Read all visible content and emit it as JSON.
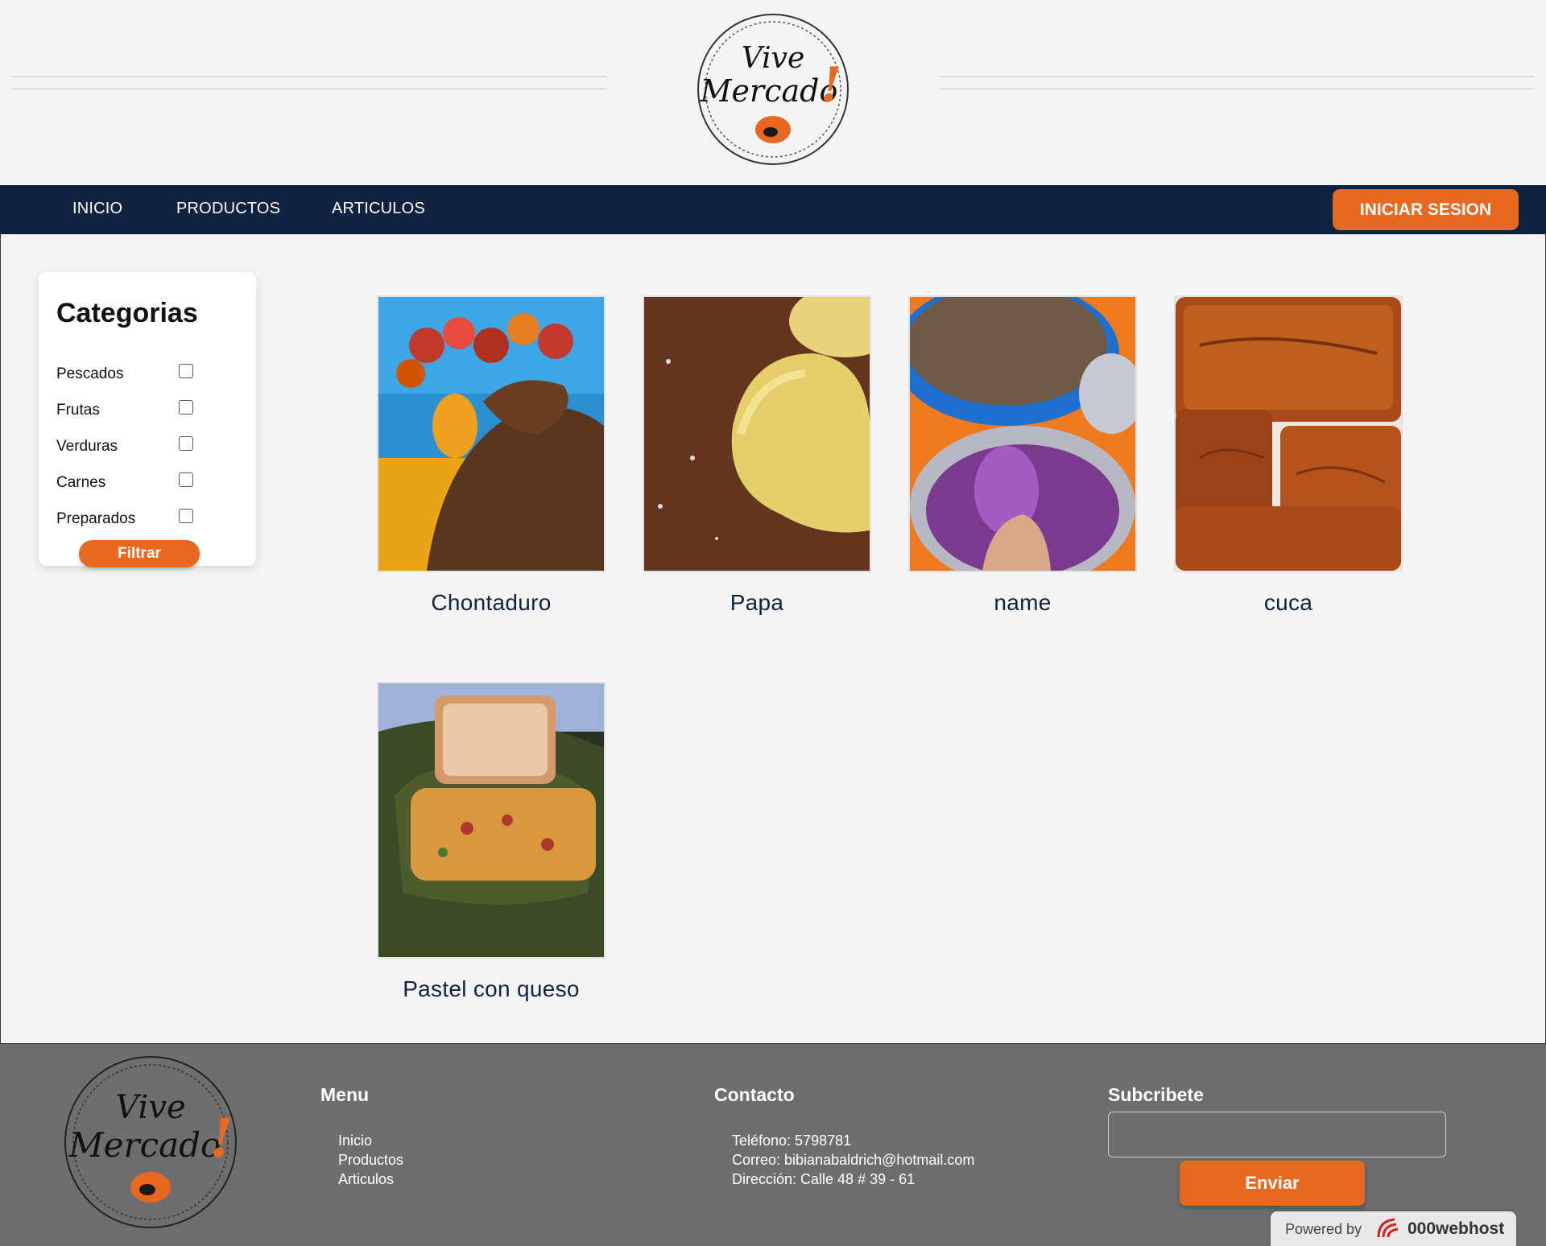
{
  "brand": {
    "logo_line1": "Vive",
    "logo_line2": "Mercado",
    "logo_mark": "!"
  },
  "nav": {
    "items": [
      "INICIO",
      "PRODUCTOS",
      "ARTICULOS"
    ],
    "login_label": "INICIAR SESION"
  },
  "categories": {
    "title": "Categorias",
    "items": [
      "Pescados",
      "Frutas",
      "Verduras",
      "Carnes",
      "Preparados"
    ],
    "filter_label": "Filtrar"
  },
  "products": [
    {
      "name": "Chontaduro"
    },
    {
      "name": "Papa"
    },
    {
      "name": "name"
    },
    {
      "name": "cuca"
    },
    {
      "name": "Pastel con queso"
    }
  ],
  "footer": {
    "menu_title": "Menu",
    "menu_items": [
      "Inicio",
      "Productos",
      "Articulos"
    ],
    "contact_title": "Contacto",
    "phone": "Teléfono: 5798781",
    "email": "Correo: bibianabaldrich@hotmail.com",
    "address": "Dirección: Calle 48 # 39 - 61",
    "subscribe_title": "Subcribete",
    "subscribe_placeholder": "",
    "send_label": "Enviar",
    "powered_by": "Powered by",
    "host_brand": "000webhost"
  },
  "colors": {
    "navy": "#0f2240",
    "accent": "#e9681f",
    "footer": "#6e6e6e"
  }
}
